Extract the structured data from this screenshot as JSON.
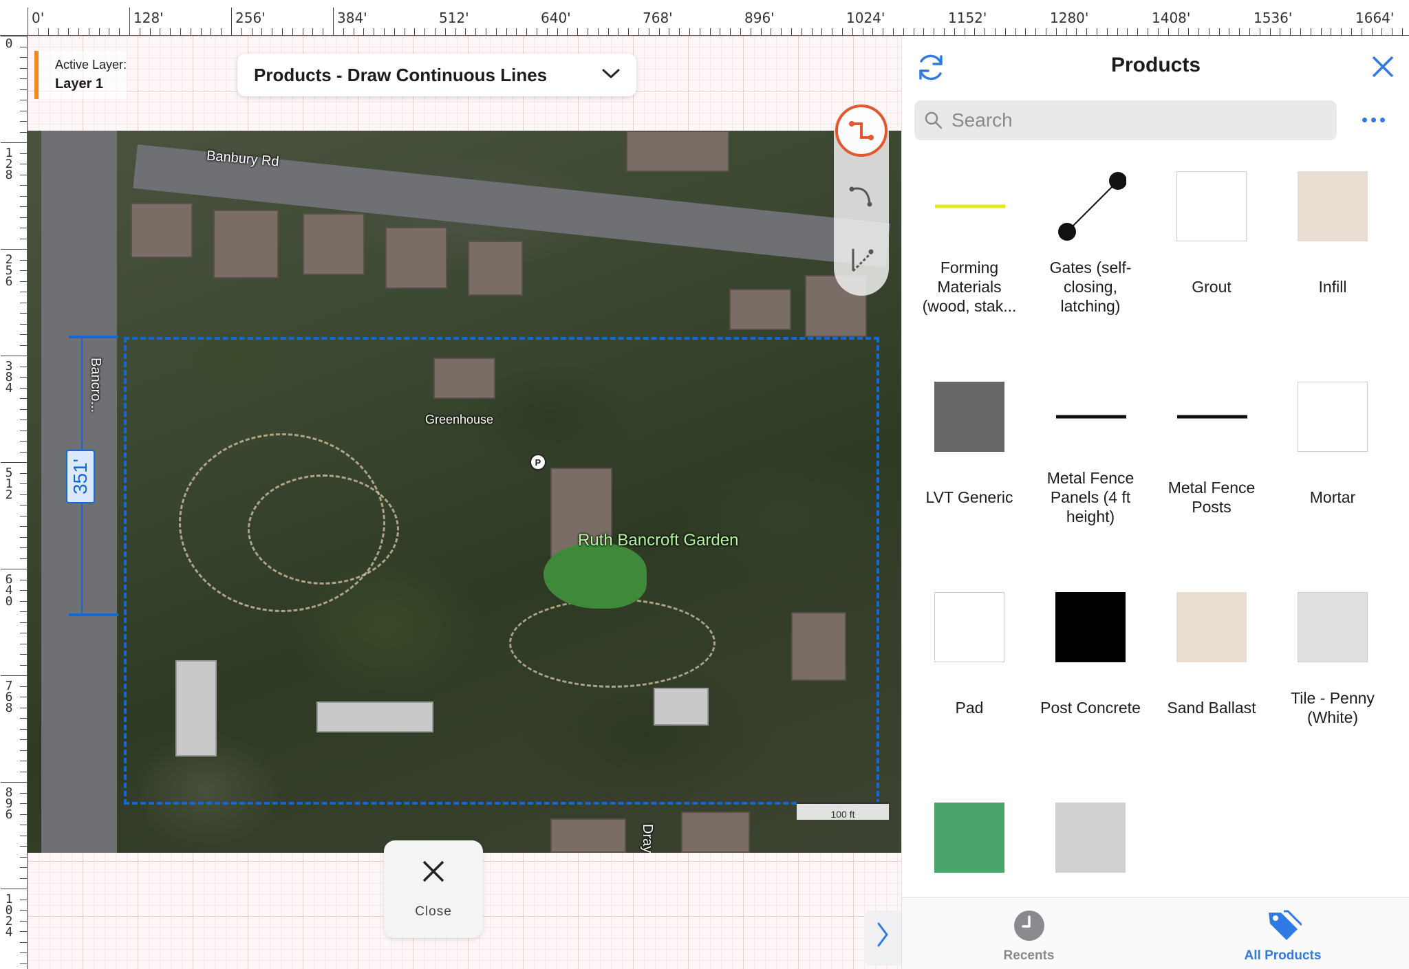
{
  "ruler": {
    "top_labels": [
      "0'",
      "128'",
      "256'",
      "384'",
      "512'",
      "640'",
      "768'",
      "896'",
      "1024'",
      "1152'",
      "1280'",
      "1408'",
      "1536'",
      "1664'"
    ],
    "left_labels": [
      "0",
      "128",
      "256",
      "384",
      "512",
      "640",
      "768",
      "896",
      "1024",
      "1"
    ]
  },
  "layer": {
    "label": "Active Layer:",
    "value": "Layer 1"
  },
  "mode": {
    "label": "Products - Draw Continuous Lines"
  },
  "map": {
    "street_banbury": "Banbury Rd",
    "street_bancroft": "Bancro...",
    "street_dray": "Dray",
    "greenhouse": "Greenhouse",
    "parking": "P",
    "garden": "Ruth Bancroft Garden",
    "scale": "100 ft",
    "dimension": "351'"
  },
  "close_button": {
    "label": "Close"
  },
  "panel": {
    "title": "Products",
    "search_placeholder": "Search",
    "products": [
      {
        "name": "Forming Materials (wood, stak...",
        "swatch": "line",
        "color": "#e6e81c"
      },
      {
        "name": "Gates (self-closing, latching)",
        "swatch": "gate",
        "color": "#111111"
      },
      {
        "name": "Grout",
        "swatch": "box",
        "color": "#ffffff"
      },
      {
        "name": "Infill",
        "swatch": "box",
        "color": "#e8ddd0"
      },
      {
        "name": "LVT Generic",
        "swatch": "box",
        "color": "#666666"
      },
      {
        "name": "Metal Fence Panels (4 ft height)",
        "swatch": "line",
        "color": "#111111"
      },
      {
        "name": "Metal Fence Posts",
        "swatch": "line",
        "color": "#111111"
      },
      {
        "name": "Mortar",
        "swatch": "box",
        "color": "#ffffff"
      },
      {
        "name": "Pad",
        "swatch": "box",
        "color": "#ffffff"
      },
      {
        "name": "Post Concrete",
        "swatch": "box",
        "color": "#000000"
      },
      {
        "name": "Sand Ballast",
        "swatch": "box",
        "color": "#e8ddd0"
      },
      {
        "name": "Tile - Penny (White)",
        "swatch": "box",
        "color": "#e0e0e0"
      },
      {
        "name": "",
        "swatch": "box",
        "color": "#4aa56a"
      },
      {
        "name": "",
        "swatch": "box",
        "color": "#d0d0d0"
      }
    ]
  },
  "tabs": {
    "recents": "Recents",
    "all_products": "All Products"
  },
  "colors": {
    "accent": "#2f7ae5",
    "layer_marker": "#f08a1a",
    "selection": "#1467d6",
    "active_tool": "#e2572f"
  }
}
